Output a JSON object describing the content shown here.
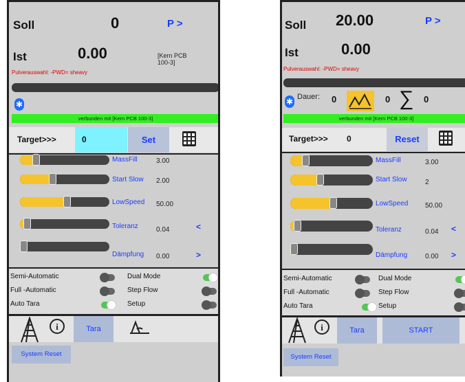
{
  "screens": [
    {
      "soll_label": "Soll",
      "soll_value": "0",
      "p_link": "P >",
      "ist_label": "Ist",
      "ist_value": "0.00",
      "kern_label": "[Kern PCB 100-3]",
      "pulver_text": "Pulverauswahl: -PWD= sheavy",
      "connection_text": "verbunden mit [Kern PCB 100-3]",
      "target_label": "Target>>>",
      "target_value": "0",
      "target_button": "Set",
      "sliders": [
        {
          "label": "MassFill",
          "value": "3.00",
          "level": 0.18
        },
        {
          "label": "Start Slow",
          "value": "2.00",
          "level": 0.36
        },
        {
          "label": "LowSpeed",
          "value": "50.00",
          "level": 0.52
        },
        {
          "label": "Toleranz",
          "value": "0.04",
          "level": 0.08,
          "arrow": "<"
        },
        {
          "label": "Dämpfung",
          "value": "0.00",
          "level": 0.02,
          "arrow": ">"
        }
      ],
      "toggles": [
        {
          "label": "Semi-Automatic",
          "on": false
        },
        {
          "label": "Dual Mode",
          "on": true
        },
        {
          "label": "Full  -Automatic",
          "on": false
        },
        {
          "label": "Step Flow",
          "on": false
        },
        {
          "label": "Auto Tara",
          "on": true
        },
        {
          "label": "Setup",
          "on": false
        }
      ],
      "tab_tara": "Tara",
      "system_reset": "System Reset"
    },
    {
      "soll_label": "Soll",
      "soll_value": "20.00",
      "p_link": "P >",
      "ist_label": "Ist",
      "ist_value": "0.00",
      "pulver_text": "Pulverauswahl: -PWD= sheavy",
      "dauer_label": "Dauer:",
      "dauer_value": "0",
      "count_value": "0",
      "sum_symbol": "∑",
      "sum_value": "0",
      "connection_text": "verbunden mit [Kern PCB 100-3]",
      "target_label": "Target>>>",
      "target_value": "0",
      "target_button": "Reset",
      "sliders": [
        {
          "label": "MassFill",
          "value": "3.00",
          "level": 0.18
        },
        {
          "label": "Start Slow",
          "value": "2",
          "level": 0.36
        },
        {
          "label": "LowSpeed",
          "value": "50.00",
          "level": 0.52
        },
        {
          "label": "Toleranz",
          "value": "0.04",
          "level": 0.08,
          "arrow": "<"
        },
        {
          "label": "Dämpfung",
          "value": "0.00",
          "level": 0.02,
          "arrow": ">"
        }
      ],
      "toggles": [
        {
          "label": "Semi-Automatic",
          "on": false
        },
        {
          "label": "Dual Mode",
          "on": true
        },
        {
          "label": "Full  -Automatic",
          "on": false
        },
        {
          "label": "Step Flow",
          "on": false
        },
        {
          "label": "Auto Tara",
          "on": true
        },
        {
          "label": "Setup",
          "on": false
        }
      ],
      "tab_tara": "Tara",
      "tab_start": "START",
      "system_reset": "System Reset"
    }
  ],
  "colors": {
    "accent_blue": "#1a3cff",
    "slider_fill": "#f5c32c",
    "connected_green": "#33ee22",
    "error_red": "#e00000",
    "toggle_on": "#53c653"
  },
  "icons": [
    "bluetooth-icon",
    "keypad-icon",
    "ladder-icon",
    "info-icon",
    "scale-icon",
    "chart-icon"
  ]
}
